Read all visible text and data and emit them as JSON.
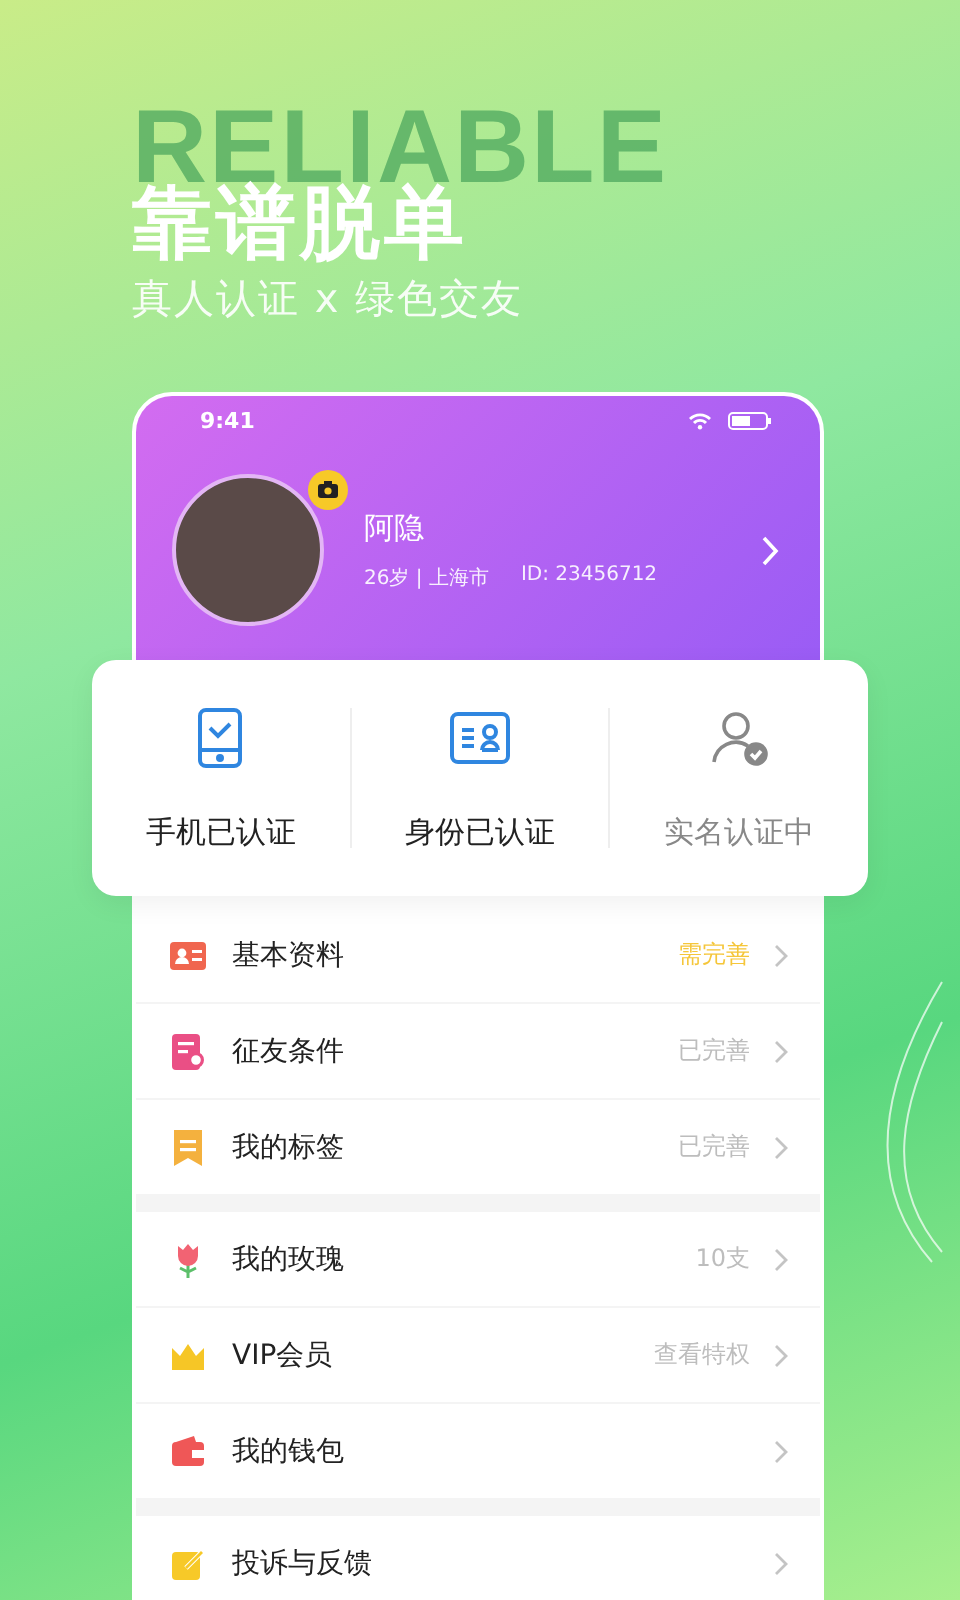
{
  "promo": {
    "backdrop_text": "RELIABLE",
    "headline": "靠谱脱单",
    "tagline": "真人认证 x 绿色交友"
  },
  "status_bar": {
    "time": "9:41"
  },
  "profile": {
    "name": "阿隐",
    "details": "26岁 | 上海市",
    "id": "ID: 23456712"
  },
  "verifications": [
    {
      "kind": "phone",
      "label": "手机已认证",
      "verified": true
    },
    {
      "kind": "idcard",
      "label": "身份已认证",
      "verified": true
    },
    {
      "kind": "person",
      "label": "实名认证中",
      "verified": false
    }
  ],
  "menu_groups": [
    [
      {
        "kind": "profile",
        "label": "基本资料",
        "value": "需完善",
        "complete": false
      },
      {
        "kind": "criteria",
        "label": "征友条件",
        "value": "已完善",
        "complete": true
      },
      {
        "kind": "tag",
        "label": "我的标签",
        "value": "已完善",
        "complete": true
      }
    ],
    [
      {
        "kind": "rose",
        "label": "我的玫瑰",
        "value": "10支"
      },
      {
        "kind": "crown",
        "label": "VIP会员",
        "value": "查看特权"
      },
      {
        "kind": "wallet",
        "label": "我的钱包"
      }
    ],
    [
      {
        "kind": "feedback",
        "label": "投诉与反馈"
      }
    ]
  ]
}
